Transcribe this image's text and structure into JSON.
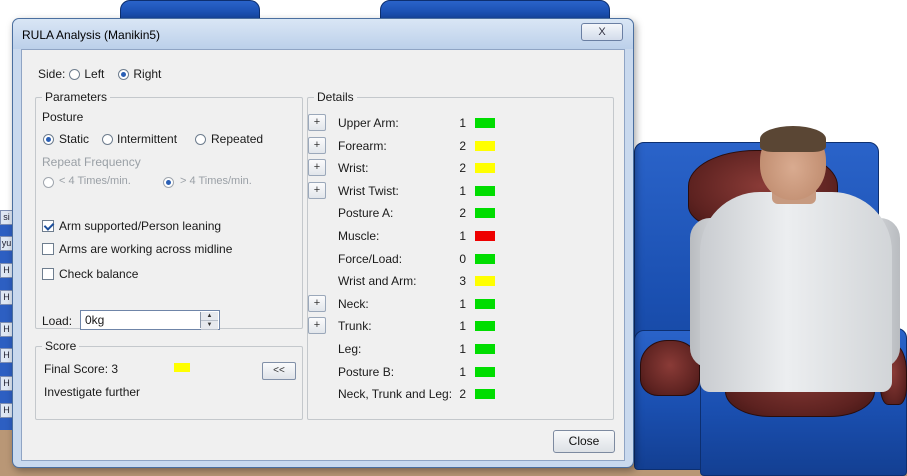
{
  "window": {
    "title": "RULA Analysis (Manikin5)",
    "close_glyph": "X",
    "close_button_label": "Close"
  },
  "side": {
    "label": "Side:",
    "options": [
      {
        "label": "Left",
        "selected": false
      },
      {
        "label": "Right",
        "selected": true
      }
    ]
  },
  "parameters": {
    "title": "Parameters",
    "posture_label": "Posture",
    "posture_options": [
      {
        "label": "Static",
        "selected": true
      },
      {
        "label": "Intermittent",
        "selected": false
      },
      {
        "label": "Repeated",
        "selected": false
      }
    ],
    "repeat_frequency_label": "Repeat Frequency",
    "repeat_options": [
      {
        "label": "< 4 Times/min.",
        "selected": false
      },
      {
        "label": "> 4 Times/min.",
        "selected": true
      }
    ],
    "checkboxes": [
      {
        "label": "Arm supported/Person leaning",
        "checked": true
      },
      {
        "label": "Arms are working across midline",
        "checked": false
      },
      {
        "label": "Check balance",
        "checked": false
      }
    ],
    "load_label": "Load:",
    "load_value": "0kg"
  },
  "score": {
    "title": "Score",
    "final_score": "Final Score: 3",
    "final_color": "#ffff00",
    "message": "Investigate further",
    "collapse_label": "<<"
  },
  "details": {
    "title": "Details",
    "expand_glyph": "+",
    "rows": [
      {
        "name": "Upper Arm:",
        "value": "1",
        "color": "#00dd00",
        "expandable": true
      },
      {
        "name": "Forearm:",
        "value": "2",
        "color": "#ffff00",
        "expandable": true
      },
      {
        "name": "Wrist:",
        "value": "2",
        "color": "#ffff00",
        "expandable": true
      },
      {
        "name": "Wrist Twist:",
        "value": "1",
        "color": "#00dd00",
        "expandable": true
      },
      {
        "name": "Posture A:",
        "value": "2",
        "color": "#00dd00",
        "expandable": false
      },
      {
        "name": "Muscle:",
        "value": "1",
        "color": "#ee0000",
        "expandable": false
      },
      {
        "name": "Force/Load:",
        "value": "0",
        "color": "#00dd00",
        "expandable": false
      },
      {
        "name": "Wrist and Arm:",
        "value": "3",
        "color": "#ffff00",
        "expandable": false
      },
      {
        "name": "Neck:",
        "value": "1",
        "color": "#00dd00",
        "expandable": true
      },
      {
        "name": "Trunk:",
        "value": "1",
        "color": "#00dd00",
        "expandable": true
      },
      {
        "name": "Leg:",
        "value": "1",
        "color": "#00dd00",
        "expandable": false
      },
      {
        "name": "Posture B:",
        "value": "1",
        "color": "#00dd00",
        "expandable": false
      },
      {
        "name": "Neck, Trunk and Leg:",
        "value": "2",
        "color": "#00dd00",
        "expandable": false
      }
    ]
  },
  "background_tabs": [
    "si",
    "yu",
    "H",
    "H",
    "H",
    "H",
    "H",
    "H"
  ]
}
